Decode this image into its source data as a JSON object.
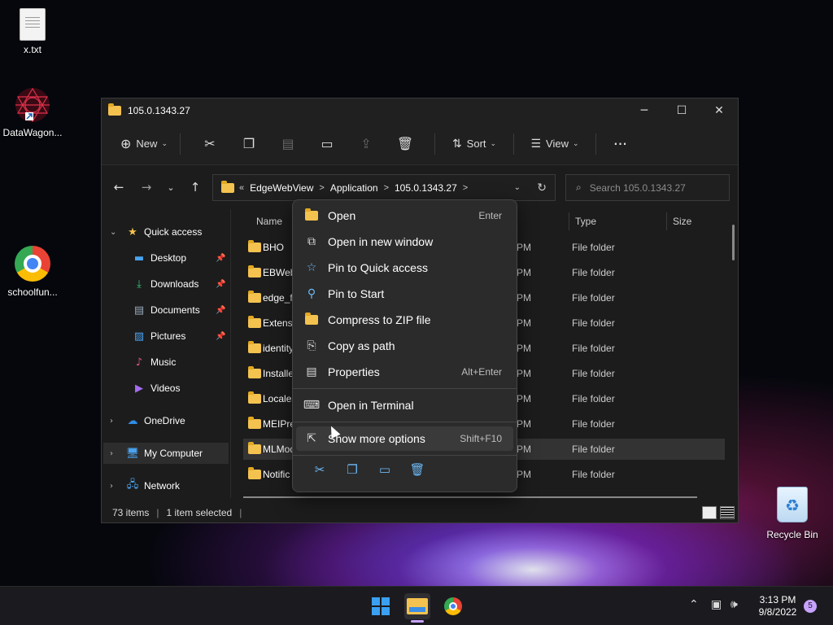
{
  "desktop": {
    "icons": [
      {
        "label": "x.txt"
      },
      {
        "label": "DataWagon..."
      },
      {
        "label": "schoolfun..."
      },
      {
        "label": "Recycle Bin"
      }
    ]
  },
  "window": {
    "title": "105.0.1343.27",
    "controls": {
      "minimize": "─",
      "maximize": "☐",
      "close": "✕"
    }
  },
  "toolbar": {
    "new_label": "New",
    "sort_label": "Sort",
    "view_label": "View",
    "more_label": "···"
  },
  "address": {
    "overflow": "«",
    "segments": [
      "EdgeWebView",
      "Application",
      "105.0.1343.27"
    ]
  },
  "search": {
    "placeholder": "Search 105.0.1343.27"
  },
  "sidebar": {
    "items": [
      {
        "label": "Quick access"
      },
      {
        "label": "Desktop"
      },
      {
        "label": "Downloads"
      },
      {
        "label": "Documents"
      },
      {
        "label": "Pictures"
      },
      {
        "label": "Music"
      },
      {
        "label": "Videos"
      },
      {
        "label": "OneDrive"
      },
      {
        "label": "My Computer"
      },
      {
        "label": "Network"
      }
    ]
  },
  "list": {
    "columns": {
      "name": "Name",
      "type": "Type",
      "size": "Size"
    },
    "rows": [
      {
        "name": "BHO",
        "date": "PM",
        "type": "File folder"
      },
      {
        "name": "EBWeb",
        "date": "PM",
        "type": "File folder"
      },
      {
        "name": "edge_fe",
        "date": "PM",
        "type": "File folder"
      },
      {
        "name": "Extensi",
        "date": "PM",
        "type": "File folder"
      },
      {
        "name": "identity",
        "date": "PM",
        "type": "File folder"
      },
      {
        "name": "Installe",
        "date": "PM",
        "type": "File folder"
      },
      {
        "name": "Locales",
        "date": "PM",
        "type": "File folder"
      },
      {
        "name": "MEIPre",
        "date": "PM",
        "type": "File folder"
      },
      {
        "name": "MLMod",
        "date": "PM",
        "type": "File folder"
      },
      {
        "name": "Notific",
        "date": "PM",
        "type": "File folder"
      }
    ]
  },
  "status": {
    "count": "73 items",
    "selected": "1 item selected",
    "sep": "|"
  },
  "context_menu": {
    "items": [
      {
        "label": "Open",
        "shortcut": "Enter"
      },
      {
        "label": "Open in new window",
        "shortcut": ""
      },
      {
        "label": "Pin to Quick access",
        "shortcut": ""
      },
      {
        "label": "Pin to Start",
        "shortcut": ""
      },
      {
        "label": "Compress to ZIP file",
        "shortcut": ""
      },
      {
        "label": "Copy as path",
        "shortcut": ""
      },
      {
        "label": "Properties",
        "shortcut": "Alt+Enter"
      },
      {
        "label": "Open in Terminal",
        "shortcut": ""
      },
      {
        "label": "Show more options",
        "shortcut": "Shift+F10"
      }
    ]
  },
  "taskbar": {
    "time": "3:13 PM",
    "date": "9/8/2022",
    "notifications": "5"
  },
  "colors": {
    "accent": "#6cb8f6",
    "folder": "#f4c24f",
    "taskbar_indicator": "#c8a2ff"
  }
}
